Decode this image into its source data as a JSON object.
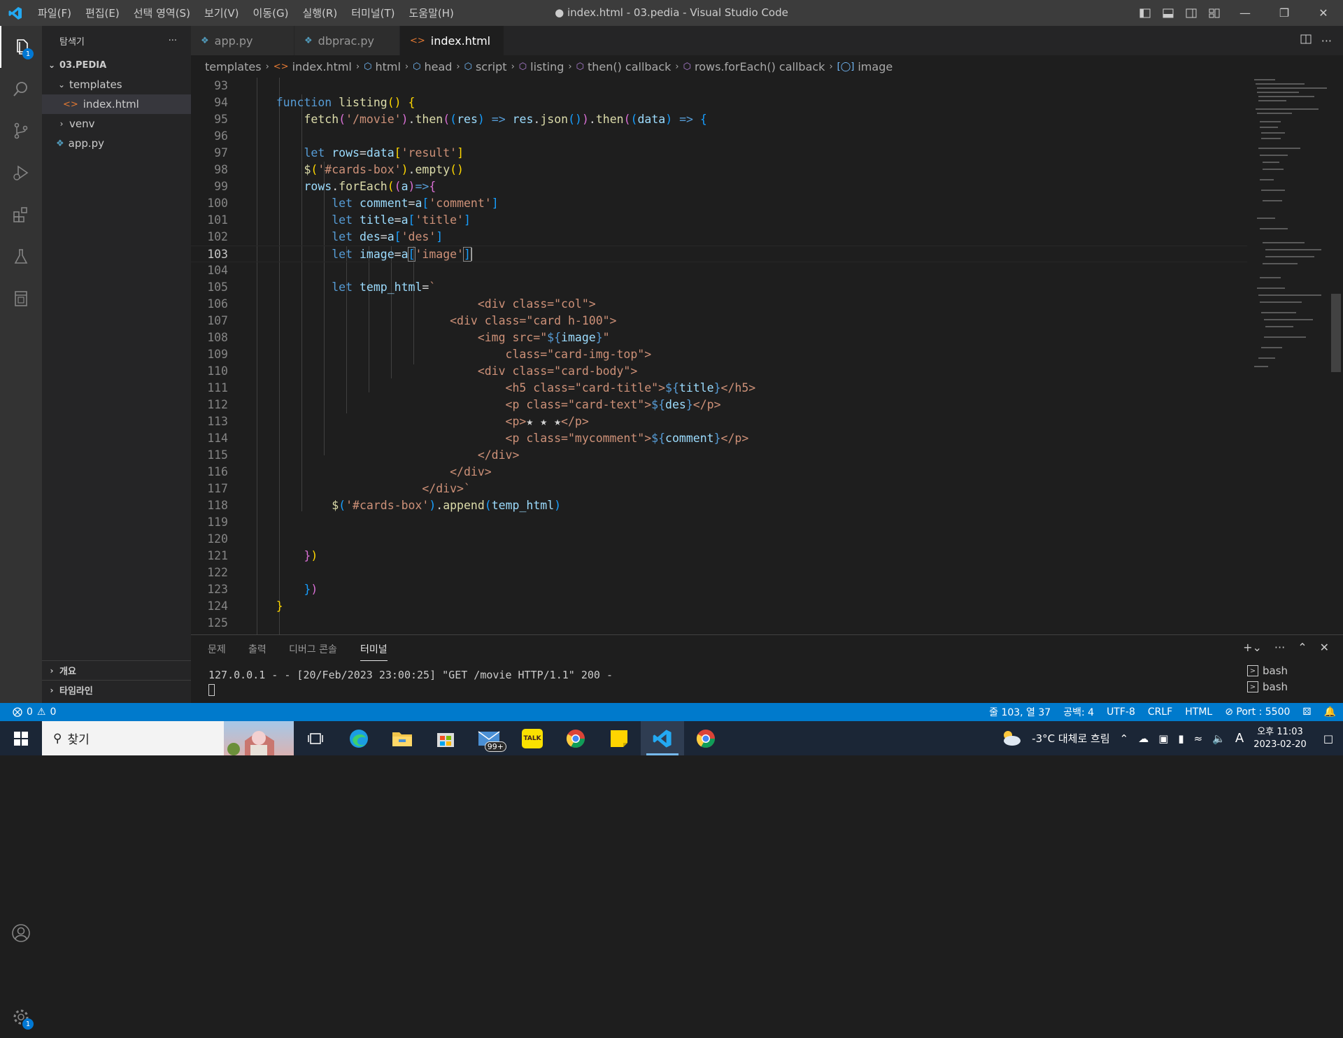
{
  "window": {
    "title": "● index.html - 03.pedia - Visual Studio Code",
    "menu": [
      "파일(F)",
      "편집(E)",
      "선택 영역(S)",
      "보기(V)",
      "이동(G)",
      "실행(R)",
      "터미널(T)",
      "도움말(H)"
    ]
  },
  "activity": {
    "explorer_badge": "1",
    "settings_badge": "1"
  },
  "sidebar": {
    "header": "탐색기",
    "more": "···",
    "root": "03.PEDIA",
    "items": [
      {
        "label": "templates",
        "type": "folder-open"
      },
      {
        "label": "index.html",
        "type": "file-html",
        "selected": true
      },
      {
        "label": "venv",
        "type": "folder-closed"
      },
      {
        "label": "app.py",
        "type": "file-py"
      }
    ],
    "outline": "개요",
    "timeline": "타임라인"
  },
  "tabs": [
    {
      "label": "app.py",
      "icon": "python-icon",
      "active": false
    },
    {
      "label": "dbprac.py",
      "icon": "python-icon",
      "active": false
    },
    {
      "label": "index.html",
      "icon": "html-icon",
      "active": true,
      "modified": true
    }
  ],
  "breadcrumb": [
    "templates",
    "index.html",
    "html",
    "head",
    "script",
    "listing",
    "then() callback",
    "rows.forEach() callback",
    "image"
  ],
  "editor": {
    "current_line": 103,
    "line_numbers": [
      "93",
      "94",
      "95",
      "96",
      "97",
      "98",
      "99",
      "100",
      "101",
      "102",
      "103",
      "104",
      "105",
      "106",
      "107",
      "108",
      "109",
      "110",
      "111",
      "112",
      "113",
      "114",
      "115",
      "116",
      "117",
      "118",
      "119",
      "120",
      "121",
      "122",
      "123",
      "124",
      "125"
    ]
  },
  "panel": {
    "tabs": [
      "문제",
      "출력",
      "디버그 콘솔",
      "터미널"
    ],
    "active_tab": "터미널",
    "terminal_line": "127.0.0.1 - - [20/Feb/2023 23:00:25] \"GET /movie HTTP/1.1\" 200 -",
    "terminals": [
      "bash",
      "bash"
    ]
  },
  "statusbar": {
    "errors": "0",
    "warnings": "0",
    "position": "줄 103, 열 37",
    "spaces": "공백: 4",
    "encoding": "UTF-8",
    "eol": "CRLF",
    "language": "HTML",
    "port": "Port : 5500"
  },
  "taskbar": {
    "search_label": "찾기",
    "mail_badge": "99+",
    "talk_label": "TALK",
    "weather": "-3°C 대체로 흐림",
    "ime": "A",
    "time": "오후 11:03",
    "date": "2023-02-20"
  },
  "colors": {
    "accent": "#007acc",
    "keyword": "#569cd6",
    "function": "#dcdcaa",
    "string": "#ce9178",
    "variable": "#9cdcfe"
  }
}
